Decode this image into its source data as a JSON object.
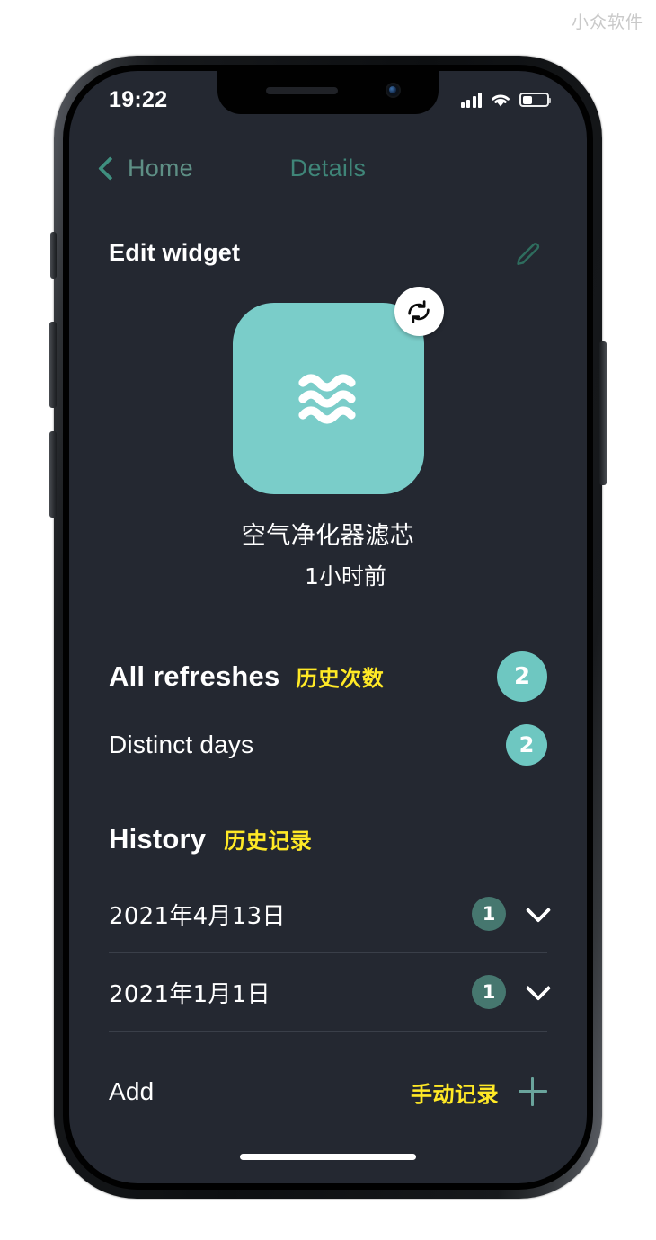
{
  "watermark": "小众软件",
  "status_bar": {
    "time": "19:22",
    "signal_icon": "cellular-signal-icon",
    "wifi_icon": "wifi-icon",
    "battery_icon": "battery-icon",
    "battery_level_percent": 35
  },
  "nav": {
    "back_label": "Home",
    "title": "Details",
    "back_icon": "chevron-left-icon"
  },
  "edit_section": {
    "title": "Edit widget",
    "edit_icon": "pencil-icon"
  },
  "widget": {
    "icon": "wave-lines-icon",
    "refresh_icon": "refresh-circular-arrows-icon",
    "name": "空气净化器滤芯",
    "last_refreshed": "1小时前",
    "tile_color": "#7acdc9"
  },
  "stats": [
    {
      "label": "All refreshes",
      "annotation": "历史次数",
      "value": "2",
      "badge_color": "#6ec7c1",
      "emphasis": "bold"
    },
    {
      "label": "Distinct days",
      "annotation": "",
      "value": "2",
      "badge_color": "#6ec7c1",
      "emphasis": "normal"
    }
  ],
  "history": {
    "title": "History",
    "annotation": "历史记录",
    "rows": [
      {
        "date": "2021年4月13日",
        "count": "1",
        "expand_icon": "chevron-down-icon"
      },
      {
        "date": "2021年1月1日",
        "count": "1",
        "expand_icon": "chevron-down-icon"
      }
    ]
  },
  "add": {
    "label": "Add",
    "annotation": "手动记录",
    "icon": "plus-icon"
  },
  "colors": {
    "screen_background": "#242831",
    "accent_teal": "#6ec7c1",
    "nav_teal": "#3f8578",
    "annotation_yellow": "#ffe926",
    "muted_badge": "#46776f"
  }
}
